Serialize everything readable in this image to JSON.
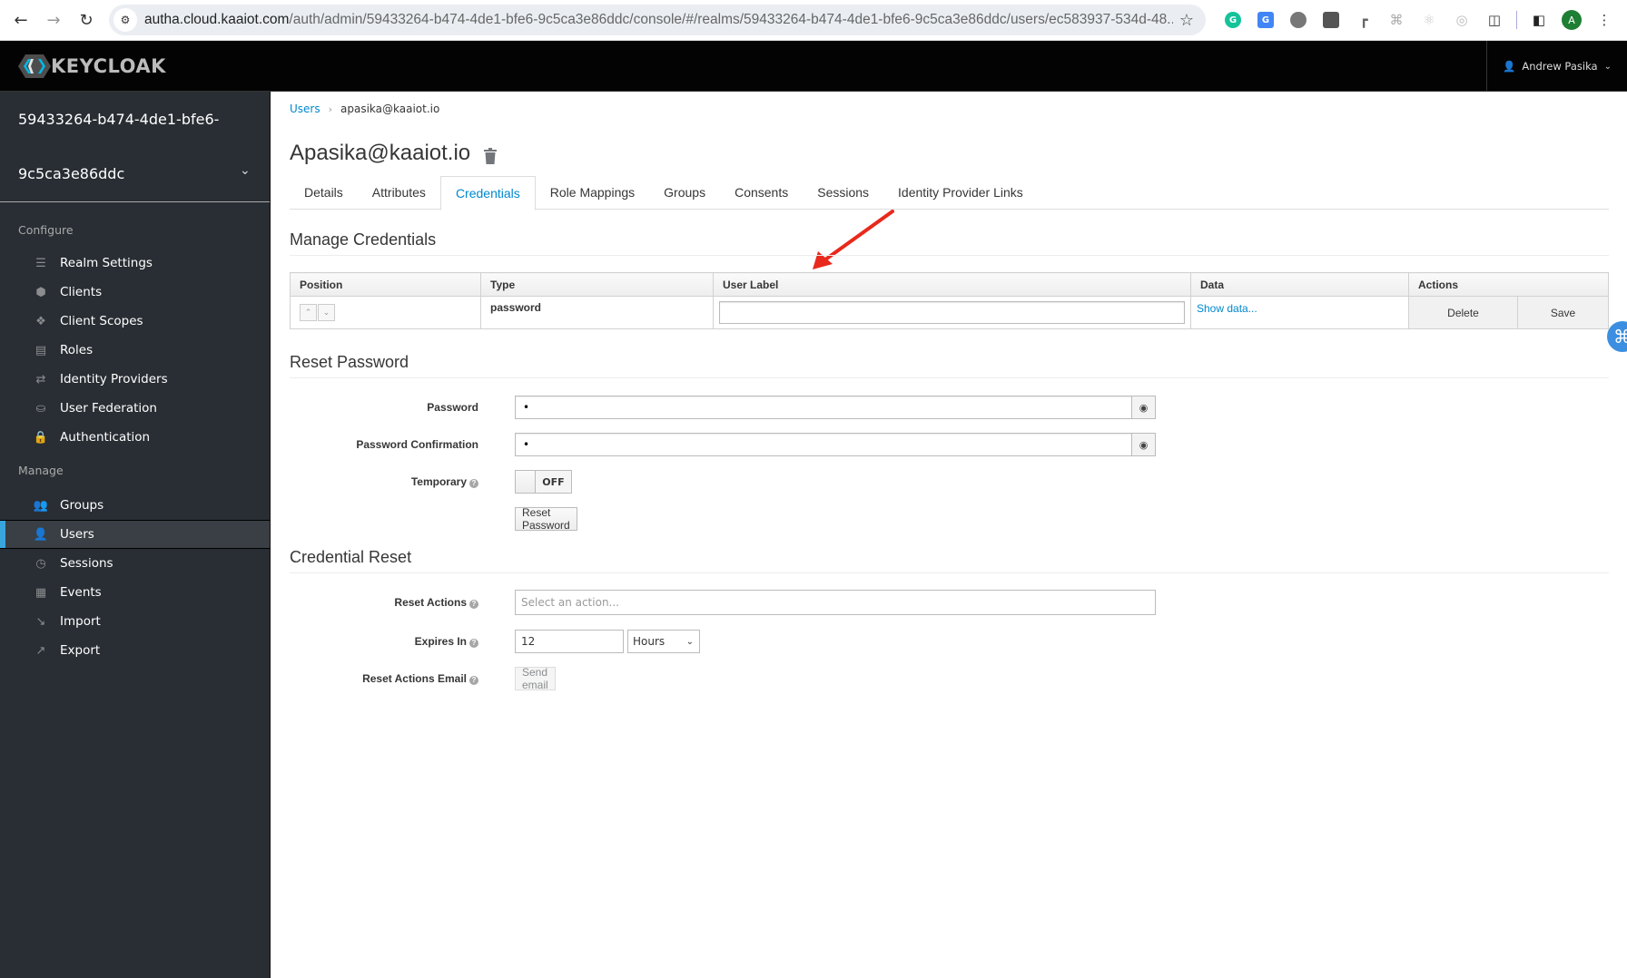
{
  "browser": {
    "url_host": "autha.cloud.kaaiot.com",
    "url_path": "/auth/admin/59433264-b474-4de1-bfe6-9c5ca3e86ddc/console/#/realms/59433264-b474-4de1-bfe6-9c5ca3e86ddc/users/ec583937-534d-48...",
    "profile_initial": "A",
    "extensions": [
      "grammarly-icon",
      "google-translate-icon",
      "circle-extension-icon",
      "extension-icon-4",
      "extension-icon-5",
      "command-extension-icon",
      "react-devtools-icon",
      "extension-icon-8",
      "puzzle-icon"
    ]
  },
  "header": {
    "brand": "KEYCLOAK",
    "user_name": "Andrew Pasika"
  },
  "sidebar": {
    "realm_line1": "59433264-b474-4de1-bfe6-",
    "realm_line2": "9c5ca3e86ddc",
    "configure_label": "Configure",
    "configure_items": [
      {
        "label": "Realm Settings",
        "icon": "sliders-icon"
      },
      {
        "label": "Clients",
        "icon": "cube-icon"
      },
      {
        "label": "Client Scopes",
        "icon": "cubes-icon"
      },
      {
        "label": "Roles",
        "icon": "list-icon"
      },
      {
        "label": "Identity Providers",
        "icon": "exchange-icon"
      },
      {
        "label": "User Federation",
        "icon": "database-icon"
      },
      {
        "label": "Authentication",
        "icon": "lock-icon"
      }
    ],
    "manage_label": "Manage",
    "manage_items": [
      {
        "label": "Groups",
        "icon": "users-icon"
      },
      {
        "label": "Users",
        "icon": "user-icon",
        "active": true
      },
      {
        "label": "Sessions",
        "icon": "clock-icon"
      },
      {
        "label": "Events",
        "icon": "calendar-icon"
      },
      {
        "label": "Import",
        "icon": "import-icon"
      },
      {
        "label": "Export",
        "icon": "export-icon"
      }
    ]
  },
  "breadcrumb": {
    "parent": "Users",
    "current": "apasika@kaaiot.io"
  },
  "page": {
    "title": "Apasika@kaaiot.io"
  },
  "tabs": [
    {
      "label": "Details"
    },
    {
      "label": "Attributes"
    },
    {
      "label": "Credentials",
      "active": true
    },
    {
      "label": "Role Mappings"
    },
    {
      "label": "Groups"
    },
    {
      "label": "Consents"
    },
    {
      "label": "Sessions"
    },
    {
      "label": "Identity Provider Links"
    }
  ],
  "manage_credentials": {
    "title": "Manage Credentials",
    "columns": [
      "Position",
      "Type",
      "User Label",
      "Data",
      "Actions"
    ],
    "rows": [
      {
        "type": "password",
        "user_label": "",
        "data_link": "Show data...",
        "actions": [
          "Delete",
          "Save"
        ]
      }
    ]
  },
  "reset_password": {
    "title": "Reset Password",
    "password_label": "Password",
    "password_value": "•",
    "confirm_label": "Password Confirmation",
    "confirm_value": "•",
    "temporary_label": "Temporary",
    "temporary_state": "OFF",
    "submit_label": "Reset Password"
  },
  "credential_reset": {
    "title": "Credential Reset",
    "reset_actions_label": "Reset Actions",
    "reset_actions_placeholder": "Select an action...",
    "expires_label": "Expires In",
    "expires_value": "12",
    "expires_unit": "Hours",
    "email_label": "Reset Actions Email",
    "send_email_label": "Send email"
  }
}
